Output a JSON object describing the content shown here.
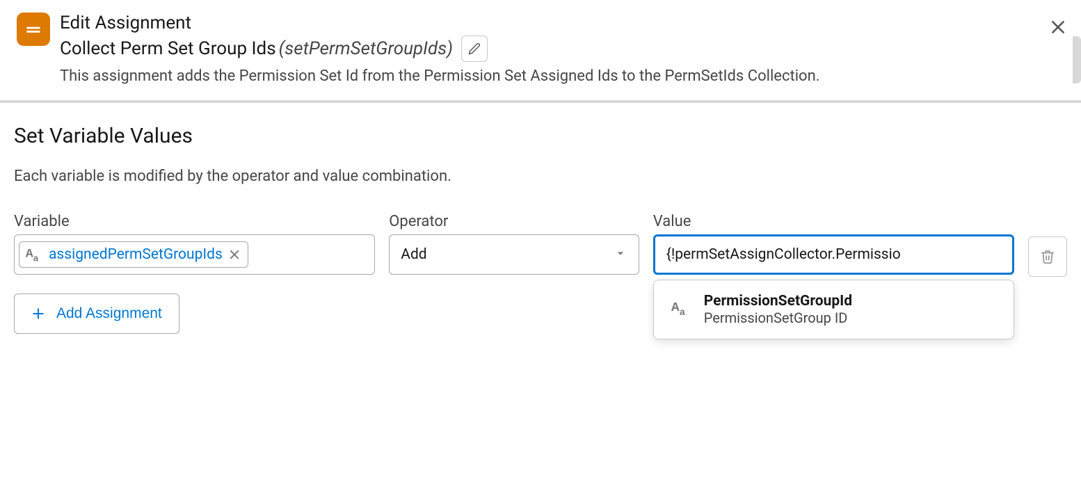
{
  "header": {
    "title": "Edit Assignment",
    "subtitle": "Collect Perm Set Group Ids",
    "api_name": "(setPermSetGroupIds)",
    "description": "This assignment adds the Permission Set Id from the Permission Set Assigned Ids to the PermSetIds Collection."
  },
  "section": {
    "title": "Set Variable Values",
    "description": "Each variable is modified by the operator and value combination."
  },
  "labels": {
    "variable": "Variable",
    "operator": "Operator",
    "value": "Value",
    "add_assignment": "Add Assignment"
  },
  "row": {
    "variable_pill": "assignedPermSetGroupIds",
    "operator_value": "Add",
    "value_input": "{!permSetAssignCollector.Permissio"
  },
  "dropdown": {
    "item_title": "PermissionSetGroupId",
    "item_sub": "PermissionSetGroup ID"
  }
}
